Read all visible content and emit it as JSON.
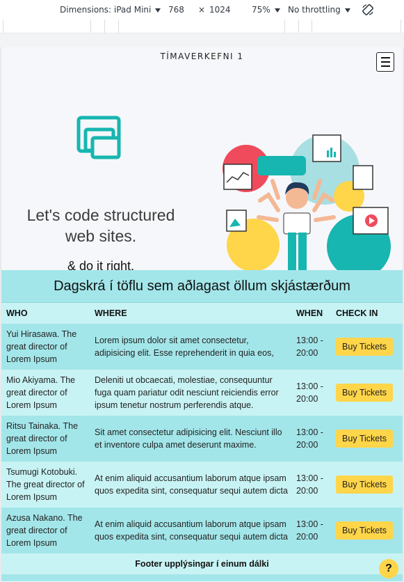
{
  "devtools": {
    "dimensions_label": "Dimensions: iPad Mini",
    "width": "768",
    "times": "×",
    "height": "1024",
    "zoom": "75%",
    "throttling": "No throttling",
    "rotate_icon": "rotate-icon"
  },
  "site": {
    "title": "TÍMAVERKEFNI 1",
    "menu_icon": "hamburger-icon"
  },
  "hero": {
    "headline_line1": "Let's code structured",
    "headline_line2": "web sites.",
    "subheadline": "& do it right.",
    "logo_icon": "windows-stack-logo",
    "illustration": "multitasking-developer-illustration"
  },
  "schedule": {
    "caption": "Dagskrá í töflu sem aðlagast öllum skjástærðum",
    "headers": {
      "who": "WHO",
      "where": "WHERE",
      "when": "WHEN",
      "check_in": "CHECK IN"
    },
    "rows": [
      {
        "who": "Yui Hirasawa. The great director of Lorem Ipsum",
        "where": "Lorem ipsum dolor sit amet consectetur, adipisicing elit. Esse reprehenderit in quia eos,",
        "when": "13:00 - 20:00",
        "button": "Buy Tickets"
      },
      {
        "who": "Mio Akiyama. The great director of Lorem Ipsum",
        "where": "Deleniti ut obcaecati, molestiae, consequuntur fuga quam pariatur odit nesciunt reiciendis error ipsum tenetur nostrum perferendis atque.",
        "when": "13:00 - 20:00",
        "button": "Buy Tickets"
      },
      {
        "who": "Ritsu Tainaka. The great director of Lorem Ipsum",
        "where": "Sit amet consectetur adipisicing elit. Nesciunt illo et inventore culpa amet deserunt maxime.",
        "when": "13:00 - 20:00",
        "button": "Buy Tickets"
      },
      {
        "who": "Tsumugi Kotobuki. The great director of Lorem Ipsum",
        "where": "At enim aliquid accusantium laborum atque ipsam quos expedita sint, consequatur sequi autem dicta",
        "when": "13:00 - 20:00",
        "button": "Buy Tickets"
      },
      {
        "who": "Azusa Nakano. The great director of Lorem Ipsum",
        "where": "At enim aliquid accusantium laborum atque ipsam quos expedita sint, consequatur sequi autem dicta",
        "when": "13:00 - 20:00",
        "button": "Buy Tickets"
      }
    ],
    "footer": "Footer upplýsingar í einum dálki"
  },
  "help": {
    "label": "?"
  },
  "colors": {
    "table_dark": "#a3e6ea",
    "table_light": "#c8f3f4",
    "button": "#ffd54a",
    "logo": "#17b6b0",
    "page_bg": "#f6f7fa"
  }
}
